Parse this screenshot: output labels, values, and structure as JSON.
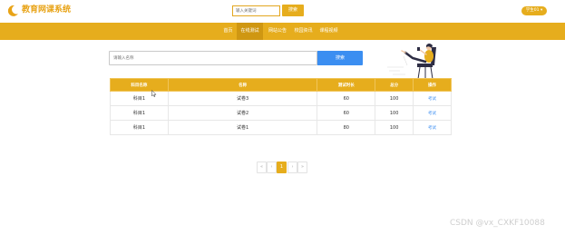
{
  "header": {
    "logo_icon": "moon-icon",
    "app_title": "教育网课系统",
    "search_placeholder": "输入关键词",
    "search_label": "搜索",
    "user_label": "学生01 ▾"
  },
  "nav": {
    "items": [
      {
        "label": "首页",
        "active": false
      },
      {
        "label": "在线测试",
        "active": true
      },
      {
        "label": "网站公告",
        "active": false
      },
      {
        "label": "校园资讯",
        "active": false
      },
      {
        "label": "课程视频",
        "active": false
      }
    ]
  },
  "search": {
    "placeholder": "请输入名称",
    "button_label": "搜索"
  },
  "table": {
    "headers": [
      "科目名称",
      "名称",
      "测试时长",
      "总分",
      "操作"
    ],
    "rows": [
      {
        "subject": "科目1",
        "name": "试卷3",
        "duration": "60",
        "score": "100",
        "action": "考试"
      },
      {
        "subject": "科目1",
        "name": "试卷2",
        "duration": "60",
        "score": "100",
        "action": "考试"
      },
      {
        "subject": "科目1",
        "name": "试卷1",
        "duration": "80",
        "score": "100",
        "action": "考试"
      }
    ]
  },
  "pagination": {
    "first": "«",
    "prev": "‹",
    "current": "1",
    "next": "›",
    "last": "»"
  },
  "watermark": "CSDN @vx_CXKF10088",
  "colors": {
    "accent": "#e6ad1d",
    "accent_dark": "#cf9712",
    "primary_blue": "#3b8ef1"
  }
}
